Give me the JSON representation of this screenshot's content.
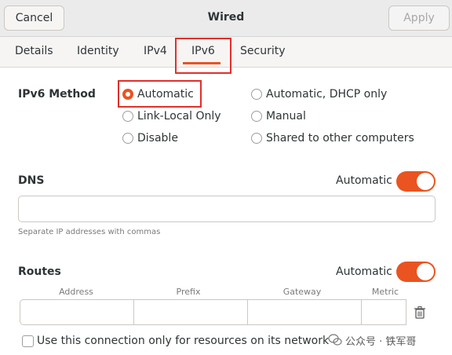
{
  "window": {
    "title": "Wired",
    "cancel_label": "Cancel",
    "apply_label": "Apply"
  },
  "tabs": [
    "Details",
    "Identity",
    "IPv4",
    "IPv6",
    "Security"
  ],
  "active_tab": "IPv6",
  "ipv6_method": {
    "label": "IPv6 Method",
    "options": [
      "Automatic",
      "Automatic, DHCP only",
      "Link-Local Only",
      "Manual",
      "Disable",
      "Shared to other computers"
    ],
    "selected": "Automatic"
  },
  "dns": {
    "label": "DNS",
    "automatic_label": "Automatic",
    "automatic_on": true,
    "value": "",
    "hint": "Separate IP addresses with commas"
  },
  "routes": {
    "label": "Routes",
    "automatic_label": "Automatic",
    "automatic_on": true,
    "columns": [
      "Address",
      "Prefix",
      "Gateway",
      "Metric"
    ],
    "only_resources_label": "Use this connection only for resources on its network",
    "only_resources_checked": false
  },
  "watermark": "公众号 · 铁军哥",
  "colors": {
    "accent": "#e95420",
    "highlight_box": "#e0302a"
  }
}
